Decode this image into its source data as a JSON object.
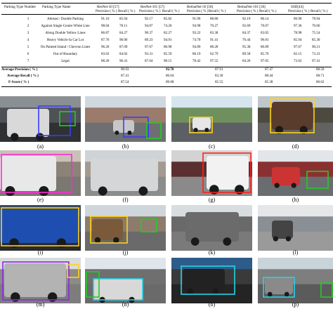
{
  "table": {
    "headers": {
      "col_number": "Parking Type Number",
      "col_name": "Parking Type Name",
      "models": [
        "ResNet-50 [57]",
        "ResNet-101 [57]",
        "RetinaNet-50 [58]",
        "RetinaNet-101 [58]",
        "SSD[44]"
      ],
      "precision": "Precision ( % )",
      "recall": "Recall ( % )"
    },
    "rows": [
      {
        "num": "1",
        "name": "Abreast / Double Parking",
        "vals": [
          "91.10",
          "85.94",
          "92.17",
          "85.82",
          "91.96",
          "88.80",
          "92.19",
          "86.14",
          "86.90",
          "78.94"
        ]
      },
      {
        "num": "2",
        "name": "Against Single Centre White Line",
        "vals": [
          "98.04",
          "78.11",
          "94.87",
          "74.20",
          "94.98",
          "70.27",
          "92.69",
          "70.07",
          "97.36",
          "70.06"
        ]
      },
      {
        "num": "3",
        "name": "Along Double Yellow Lines",
        "vals": [
          "86.87",
          "84.27",
          "90.37",
          "82.27",
          "93.22",
          "83.38",
          "84.37",
          "83.65",
          "78.98",
          "75.54"
        ]
      },
      {
        "num": "4",
        "name": "Heavy Vehicle In Car Lot",
        "vals": [
          "87.76",
          "96.06",
          "89.23",
          "94.91",
          "74.70",
          "91.41",
          "76.44",
          "96.81",
          "85.94",
          "85.30"
        ]
      },
      {
        "num": "5",
        "name": "On Painted Island / Chevron Lines",
        "vals": [
          "96.20",
          "87.09",
          "97.67",
          "86.98",
          "94.89",
          "88.28",
          "95.38",
          "86.89",
          "97.67",
          "90.21"
        ]
      },
      {
        "num": "6",
        "name": "Out of Boundary",
        "vals": [
          "83.02",
          "84.02",
          "93.31",
          "85.59",
          "86.19",
          "62.79",
          "89.58",
          "85.70",
          "82.15",
          "73.23"
        ]
      },
      {
        "num": "7",
        "name": "Legal",
        "vals": [
          "88.20",
          "96.41",
          "87.64",
          "98.15",
          "78.42",
          "97.55",
          "84.20",
          "97.65",
          "73.62",
          "97.41"
        ]
      }
    ],
    "summary": [
      {
        "label": "Average Precision ( % )",
        "vals": [
          "90.93",
          "92.78",
          "87.91",
          "87.47",
          "88.50"
        ]
      },
      {
        "label": "Average Recall ( % )",
        "vals": [
          "87.41",
          "86.64",
          "83.30",
          "88.44",
          "68.71"
        ]
      },
      {
        "label": "F-Score ( % )",
        "vals": [
          "87.54",
          "89.08",
          "85.55",
          "85.38",
          "80.62"
        ]
      }
    ]
  },
  "captions": [
    "(a)",
    "(b)",
    "(c)",
    "(d)",
    "(e)",
    "(f)",
    "(g)",
    "(h)",
    "(i)",
    "(j)",
    "(k)",
    "(l)",
    "(m)",
    "(n)",
    "(o)",
    "(p)"
  ],
  "box_colors": {
    "blue": "#3b3bff",
    "green": "#22cc22",
    "yellow": "#ffd21a",
    "magenta": "#ff2bd6",
    "purple": "#8a2be2",
    "cyan": "#27d3e8",
    "red": "#ff2020"
  }
}
